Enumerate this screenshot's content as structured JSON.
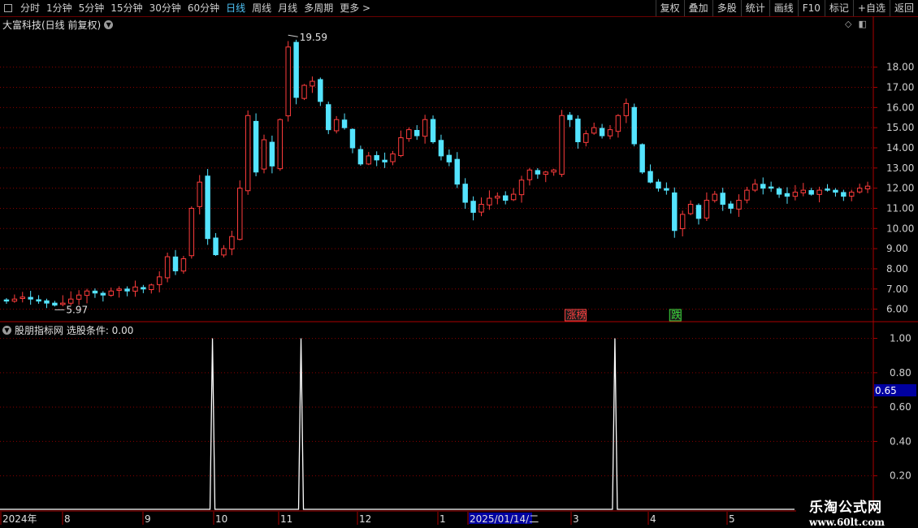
{
  "toolbar": {
    "periods": [
      "分时",
      "1分钟",
      "5分钟",
      "15分钟",
      "30分钟",
      "60分钟",
      "日线",
      "周线",
      "月线",
      "多周期",
      "更多 >"
    ],
    "active_index": 6,
    "right_buttons": [
      "复权",
      "叠加",
      "多股",
      "统计",
      "画线",
      "F10",
      "标记",
      "+自选",
      "返回"
    ]
  },
  "chart_title": "大富科技(日线 前复权)",
  "indicator_title": "股朋指标网  选股条件: 0.00",
  "price_axis": [
    "18.00",
    "17.00",
    "16.00",
    "15.00",
    "14.00",
    "13.00",
    "12.00",
    "11.00",
    "10.00",
    "9.00",
    "8.00",
    "7.00",
    "6.00"
  ],
  "indicator_axis": [
    "1.00",
    "0.80",
    "0.60",
    "0.40",
    "0.20"
  ],
  "indicator_cursor_value": "0.65",
  "high_label": "19.59",
  "low_label": "5.97",
  "events": [
    {
      "label": "涨榜",
      "color": "#ff4040"
    },
    {
      "label": "跌",
      "color": "#3ddc3d"
    }
  ],
  "time_axis": [
    "2024年",
    "8",
    "9",
    "10",
    "11",
    "12",
    "1",
    "2025/01/14/二",
    "3",
    "4",
    "5"
  ],
  "logo": {
    "line1": "乐淘公式网",
    "line2": "www.60lt.com"
  },
  "colors": {
    "up": "#ff3c3c",
    "down": "#54e4ff",
    "grid": "#8a0000",
    "signal": "#ffffff",
    "axis_text": "#d0d0d0",
    "cursor_bg": "#0000a0"
  },
  "chart_data": {
    "type": "candlestick",
    "ylim": [
      5.5,
      19.8
    ],
    "price_ticks": [
      18,
      17,
      16,
      15,
      14,
      13,
      12,
      11,
      10,
      9,
      8,
      7,
      6
    ],
    "indicator_ylim": [
      0,
      1.05
    ],
    "indicator_ticks": [
      1.0,
      0.8,
      0.6,
      0.4,
      0.2
    ],
    "close_path": [
      6.4,
      6.5,
      6.6,
      6.5,
      6.4,
      6.3,
      6.2,
      6.3,
      6.5,
      6.7,
      6.9,
      6.8,
      6.7,
      6.9,
      7.0,
      6.9,
      7.1,
      7.0,
      7.2,
      7.6,
      8.6,
      7.9,
      8.5,
      11.0,
      12.3,
      9.5,
      8.7,
      9.0,
      9.6,
      12.0,
      15.6,
      12.8,
      14.4,
      13.1,
      15.4,
      19.0,
      16.5,
      17.1,
      17.3,
      16.3,
      14.9,
      15.4,
      15.0,
      14.0,
      13.2,
      13.6,
      13.4,
      13.3,
      13.7,
      14.5,
      14.9,
      14.6,
      15.4,
      14.3,
      13.6,
      13.3,
      12.2,
      11.3,
      10.8,
      11.2,
      11.5,
      11.6,
      11.4,
      11.7,
      12.4,
      12.9,
      12.7,
      12.8,
      12.9,
      15.6,
      15.4,
      14.3,
      14.7,
      15.0,
      14.6,
      14.9,
      15.6,
      16.2,
      14.2,
      12.8,
      12.3,
      12.0,
      11.9,
      9.9,
      10.7,
      11.2,
      10.5,
      11.4,
      11.7,
      11.2,
      11.0,
      11.4,
      11.9,
      12.2,
      12.0,
      12.0,
      11.7,
      11.6,
      11.8,
      11.9,
      11.7,
      11.9,
      11.9,
      11.8,
      11.6,
      11.8,
      12.0,
      12.1
    ],
    "signals": [
      {
        "index": 26,
        "value": 1.0
      },
      {
        "index": 37,
        "value": 1.0
      },
      {
        "index": 76,
        "value": 1.0
      }
    ],
    "high": {
      "value": 19.59
    },
    "low": {
      "value": 5.97
    }
  }
}
